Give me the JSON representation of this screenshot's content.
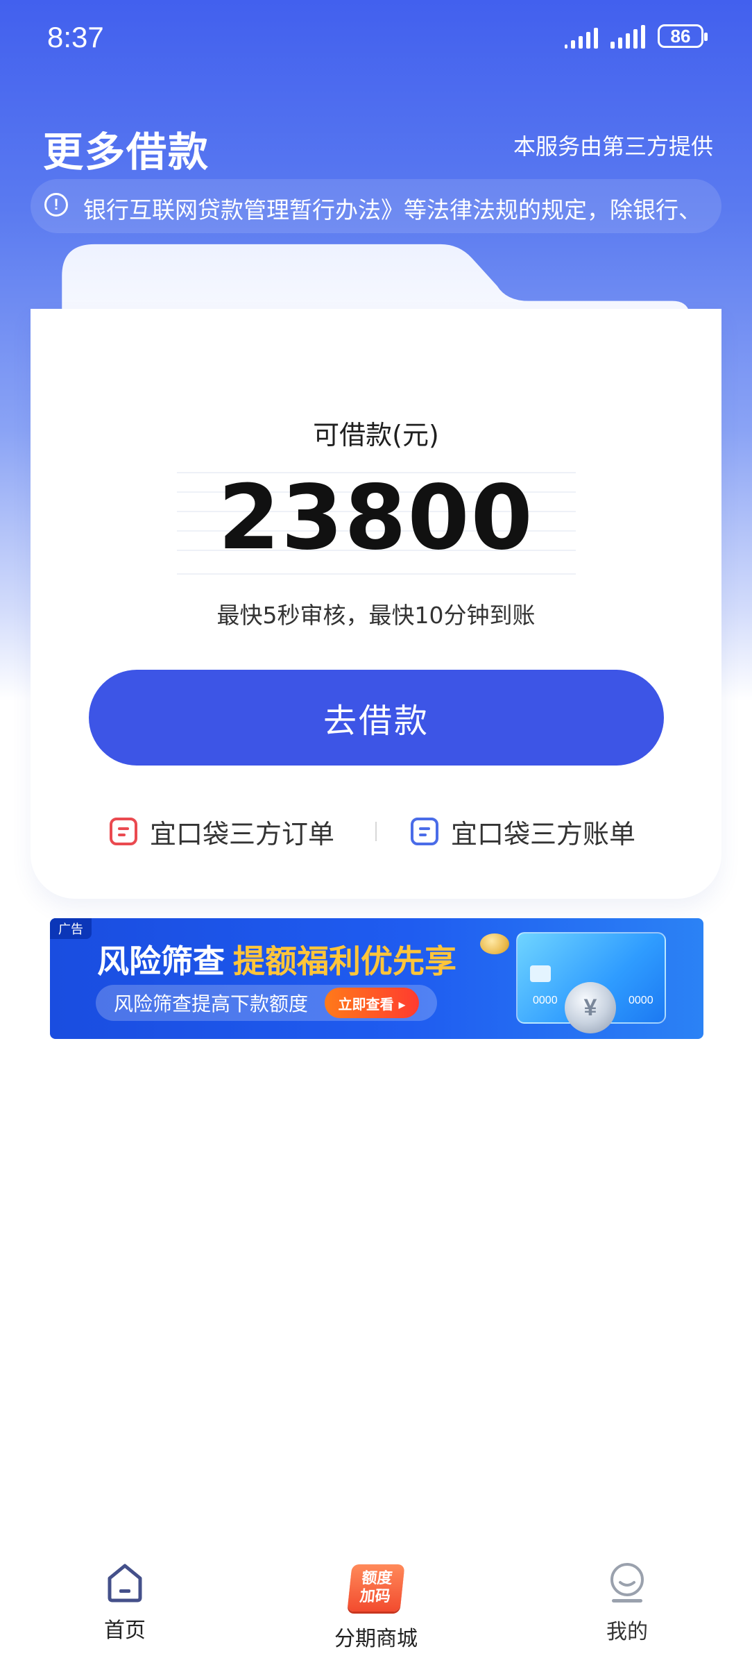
{
  "status_bar": {
    "time": "8:37",
    "battery_level": "86",
    "signal_strength": 5
  },
  "header": {
    "title": "更多借款",
    "provider_note": "本服务由第三方提供"
  },
  "notice": {
    "icon": "exclamation-circle-icon",
    "text": "银行互联网贷款管理暂行办法》等法律法规的规定，除银行、"
  },
  "loan_card": {
    "label": "可借款(元)",
    "amount": "23800",
    "review_note": "最快5秒审核，最快10分钟到账",
    "borrow_button_label": "去借款",
    "orders_link_label": "宜口袋三方订单",
    "bills_link_label": "宜口袋三方账单"
  },
  "ad_banner": {
    "tag": "广告",
    "headline": "风险筛查",
    "highlight": "提额福利优先享",
    "subline": "风险筛查提高下款额度",
    "cta": "立即查看 ▸",
    "card_number_left": "0000",
    "card_number_right": "0000",
    "coin_symbol": "¥"
  },
  "tab_bar": {
    "items": [
      {
        "label": "首页",
        "icon": "home-icon",
        "active": true
      },
      {
        "label": "分期商城",
        "icon": "promo-badge-icon",
        "badge_line1": "额度",
        "badge_line2": "加码"
      },
      {
        "label": "我的",
        "icon": "profile-icon"
      }
    ]
  },
  "colors": {
    "brand_blue": "#3d55e6",
    "header_gradient_top": "#4260ee",
    "ad_highlight": "#ffc53a",
    "order_icon": "#ea4a50",
    "bill_icon": "#4a6ce8",
    "home_icon": "#44508a"
  }
}
